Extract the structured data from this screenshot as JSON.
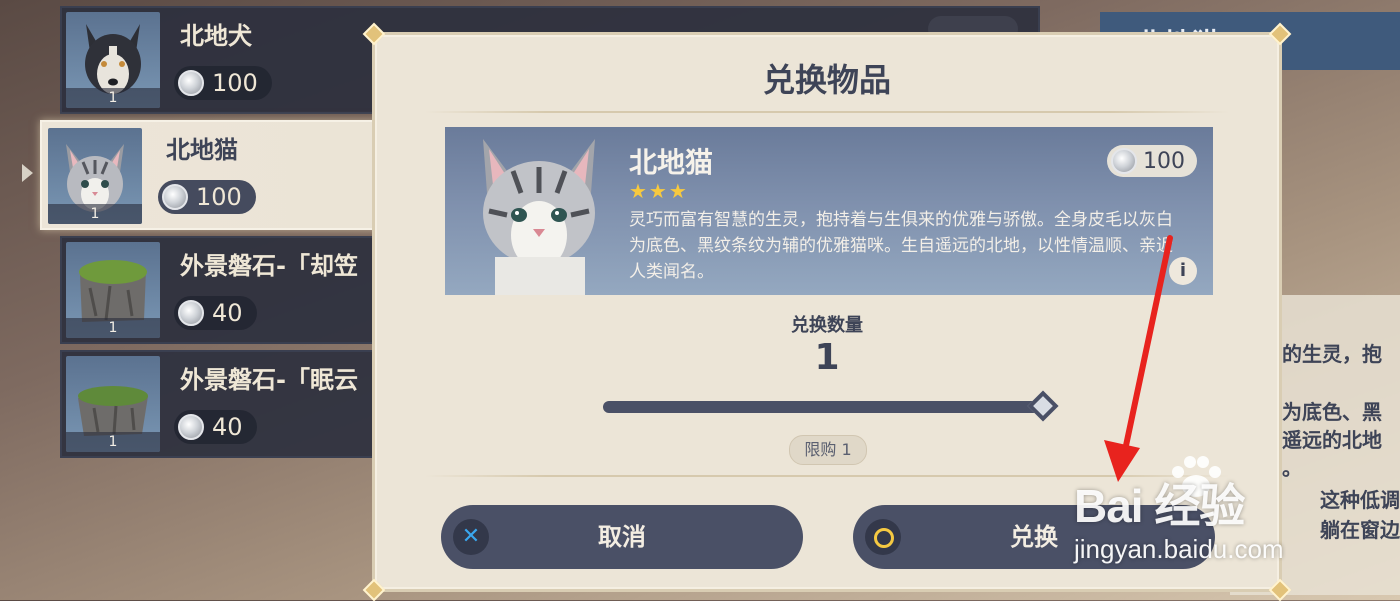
{
  "shop_list": {
    "items": [
      {
        "name": "北地犬",
        "price": "100",
        "count": "1"
      },
      {
        "name": "北地猫",
        "price": "100",
        "count": "1"
      },
      {
        "name": "外景磐石-「却笠",
        "price": "40",
        "count": "1"
      },
      {
        "name": "外景磐石-「眠云",
        "price": "40",
        "count": "1"
      }
    ]
  },
  "right_panel": {
    "title": "北地猫",
    "desc_lines": [
      "慧的生灵，抱",
      "白为底色、黑",
      "自遥远的北地",
      "名。",
      "这种低调",
      "躺在窗边"
    ]
  },
  "modal": {
    "title": "兑换物品",
    "item": {
      "name": "北地猫",
      "stars": "★★★",
      "price": "100",
      "desc": "灵巧而富有智慧的生灵，抱持着与生俱来的优雅与骄傲。全身皮毛以灰白为底色、黑纹条纹为辅的优雅猫咪。生自遥远的北地，以性情温顺、亲近人类闻名。",
      "info_icon": "info-icon"
    },
    "quantity_label": "兑换数量",
    "quantity_value": "1",
    "quantity_slider_fraction": 1.0,
    "limit_label": "限购 1",
    "cancel_label": "取消",
    "confirm_label": "兑换"
  },
  "watermark": {
    "logo_text": "Bai 经验",
    "url": "jingyan.baidu.com"
  },
  "colors": {
    "accent_dark": "#4a5066",
    "card_blue": "#7f90ad",
    "star_gold": "#f7c93f",
    "arrow_red": "#e8231e"
  }
}
